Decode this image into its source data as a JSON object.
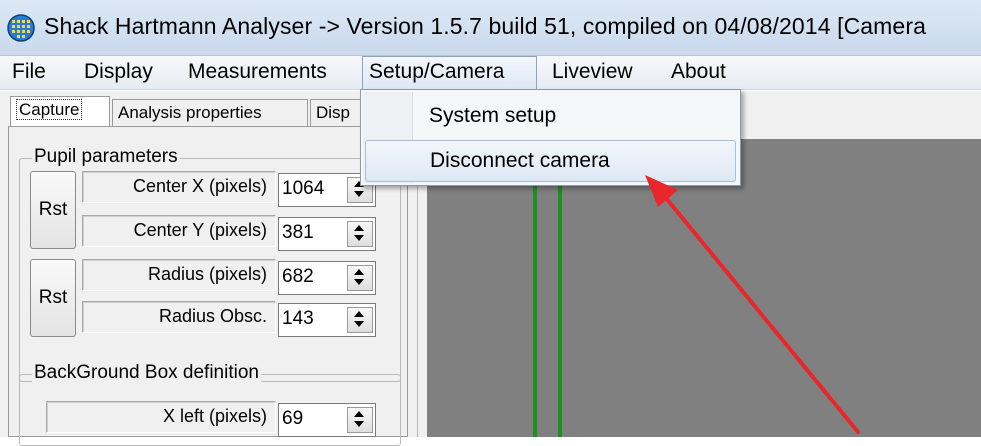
{
  "window": {
    "title": "Shack Hartmann Analyser ->  Version  1.5.7 build 51, compiled on 04/08/2014 [Camera"
  },
  "menu": {
    "items": [
      "File",
      "Display",
      "Measurements",
      "Setup/Camera",
      "Liveview",
      "About"
    ],
    "open_menu": "Setup/Camera"
  },
  "dropdown": {
    "items": [
      "System setup",
      "Disconnect camera"
    ],
    "highlighted": "Disconnect camera"
  },
  "tabs": [
    "Capture",
    "Analysis properties",
    "Disp"
  ],
  "active_tab": "Capture",
  "pupil": {
    "title": "Pupil parameters",
    "rst1": "Rst",
    "rst2": "Rst",
    "center_x_label": "Center X (pixels)",
    "center_x_value": "1064",
    "center_y_label": "Center Y (pixels)",
    "center_y_value": "381",
    "radius_label": "Radius (pixels)",
    "radius_value": "682",
    "radius_obsc_label": "Radius Obsc.",
    "radius_obsc_value": "143"
  },
  "background_box": {
    "title": "BackGround Box definition",
    "x_left_label": "X left (pixels)",
    "x_left_value": "69"
  },
  "icons": {
    "app": "globe-grid-icon",
    "spin": "spin-updown-icon",
    "annotation": "red-arrow-annotation"
  },
  "colors": {
    "annotation_arrow": "#e8262b",
    "canvas": "#808080",
    "grid_line": "#1f8f1f"
  }
}
